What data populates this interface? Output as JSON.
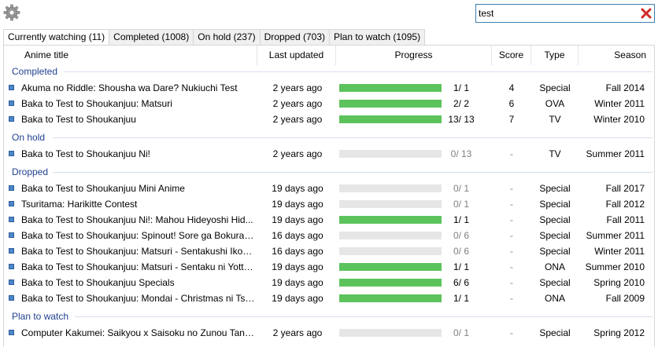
{
  "search": {
    "value": "test"
  },
  "tabs": [
    {
      "label": "Currently watching (11)"
    },
    {
      "label": "Completed (1008)"
    },
    {
      "label": "On hold (237)"
    },
    {
      "label": "Dropped (703)"
    },
    {
      "label": "Plan to watch (1095)"
    }
  ],
  "columns": {
    "title": "Anime title",
    "updated": "Last updated",
    "progress": "Progress",
    "score": "Score",
    "type": "Type",
    "season": "Season"
  },
  "groups": {
    "completed": {
      "name": "Completed",
      "rows": [
        {
          "title": "Akuma no Riddle: Shousha wa Dare? Nukiuchi Test",
          "updated": "2 years ago",
          "progress": "1/ 1",
          "fraction": 1,
          "score": "4",
          "type": "Special",
          "season": "Fall 2014"
        },
        {
          "title": "Baka to Test to Shoukanjuu: Matsuri",
          "updated": "2 years ago",
          "progress": "2/ 2",
          "fraction": 1,
          "score": "6",
          "type": "OVA",
          "season": "Winter 2011"
        },
        {
          "title": "Baka to Test to Shoukanjuu",
          "updated": "2 years ago",
          "progress": "13/ 13",
          "fraction": 1,
          "score": "7",
          "type": "TV",
          "season": "Winter 2010"
        }
      ]
    },
    "onhold": {
      "name": "On hold",
      "rows": [
        {
          "title": "Baka to Test to Shoukanjuu Ni!",
          "updated": "2 years ago",
          "progress": "0/ 13",
          "fraction": 0,
          "score": "-",
          "type": "TV",
          "season": "Summer 2011"
        }
      ]
    },
    "dropped": {
      "name": "Dropped",
      "rows": [
        {
          "title": "Baka to Test to Shoukanjuu Mini Anime",
          "updated": "19 days ago",
          "progress": "0/ 1",
          "fraction": 0,
          "score": "-",
          "type": "Special",
          "season": "Fall 2017"
        },
        {
          "title": "Tsuritama: Harikitte Contest",
          "updated": "19 days ago",
          "progress": "0/ 1",
          "fraction": 0,
          "score": "-",
          "type": "Special",
          "season": "Fall 2012"
        },
        {
          "title": "Baka to Test to Shoukanjuu Ni!: Mahou Hideyoshi Hid...",
          "updated": "19 days ago",
          "progress": "1/ 1",
          "fraction": 1,
          "score": "-",
          "type": "Special",
          "season": "Fall 2011"
        },
        {
          "title": "Baka to Test to Shoukanjuu: Spinout! Sore ga Bokura n...",
          "updated": "16 days ago",
          "progress": "0/ 6",
          "fraction": 0,
          "score": "-",
          "type": "Special",
          "season": "Summer 2011"
        },
        {
          "title": "Baka to Test to Shoukanjuu: Matsuri - Sentakushi Ikou ...",
          "updated": "16 days ago",
          "progress": "0/ 6",
          "fraction": 0,
          "score": "-",
          "type": "Special",
          "season": "Winter 2011"
        },
        {
          "title": "Baka to Test to Shoukanjuu: Matsuri - Sentaku ni Yotte ...",
          "updated": "19 days ago",
          "progress": "1/ 1",
          "fraction": 1,
          "score": "-",
          "type": "ONA",
          "season": "Summer 2010"
        },
        {
          "title": "Baka to Test to Shoukanjuu Specials",
          "updated": "19 days ago",
          "progress": "6/ 6",
          "fraction": 1,
          "score": "-",
          "type": "Special",
          "season": "Spring 2010"
        },
        {
          "title": "Baka to Test to Shoukanjuu: Mondai - Christmas ni Tsu...",
          "updated": "19 days ago",
          "progress": "1/ 1",
          "fraction": 1,
          "score": "-",
          "type": "ONA",
          "season": "Fall 2009"
        }
      ]
    },
    "plantowatch": {
      "name": "Plan to watch",
      "rows": [
        {
          "title": "Computer Kakumei: Saikyou x Saisoku no Zunou Tanjou",
          "updated": "2 years ago",
          "progress": "0/ 1",
          "fraction": 0,
          "score": "-",
          "type": "Special",
          "season": "Spring 2012"
        }
      ]
    }
  }
}
